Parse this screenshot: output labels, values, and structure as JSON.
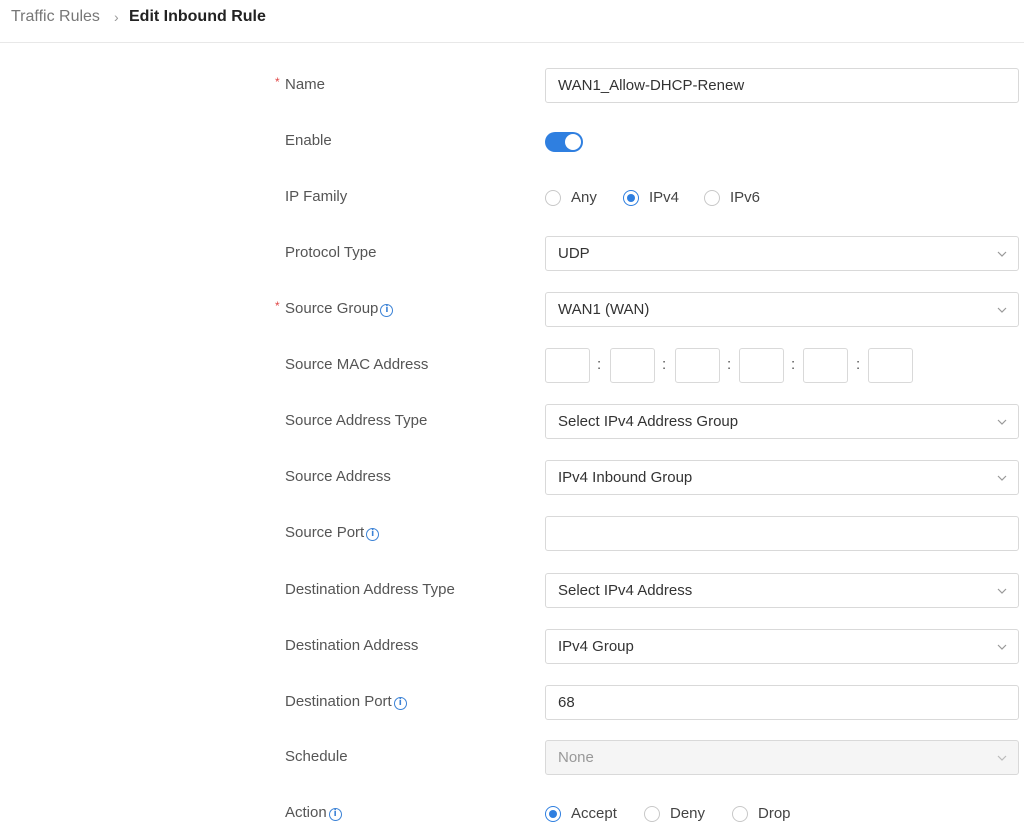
{
  "breadcrumb": {
    "parent": "Traffic Rules",
    "separator": "›",
    "current": "Edit Inbound Rule"
  },
  "form": {
    "name": {
      "label": "Name",
      "required": "*",
      "value": "WAN1_Allow-DHCP-Renew"
    },
    "enable": {
      "label": "Enable",
      "on": true
    },
    "ip_family": {
      "label": "IP Family",
      "options": [
        "Any",
        "IPv4",
        "IPv6"
      ],
      "selected": "IPv4"
    },
    "protocol_type": {
      "label": "Protocol Type",
      "value": "UDP"
    },
    "source_group": {
      "label": "Source Group",
      "required": "*",
      "value": "WAN1 (WAN)"
    },
    "source_mac": {
      "label": "Source MAC Address",
      "separator": ":",
      "octets": [
        "",
        "",
        "",
        "",
        "",
        ""
      ]
    },
    "source_address_type": {
      "label": "Source Address Type",
      "value": "Select IPv4 Address Group"
    },
    "source_address": {
      "label": "Source Address",
      "value": "IPv4 Inbound Group"
    },
    "source_port": {
      "label": "Source Port",
      "value": ""
    },
    "destination_address_type": {
      "label": "Destination Address Type",
      "value": "Select IPv4 Address"
    },
    "destination_address": {
      "label": "Destination Address",
      "value": "IPv4 Group"
    },
    "destination_port": {
      "label": "Destination Port",
      "value": "68"
    },
    "schedule": {
      "label": "Schedule",
      "value": "None",
      "disabled": true
    },
    "action": {
      "label": "Action",
      "options": [
        "Accept",
        "Deny",
        "Drop"
      ],
      "selected": "Accept"
    }
  },
  "icons": {
    "info": "info-circle-icon",
    "chevron": "chevron-down-icon"
  },
  "colors": {
    "accent": "#2f7fe0",
    "required": "#e04848"
  }
}
